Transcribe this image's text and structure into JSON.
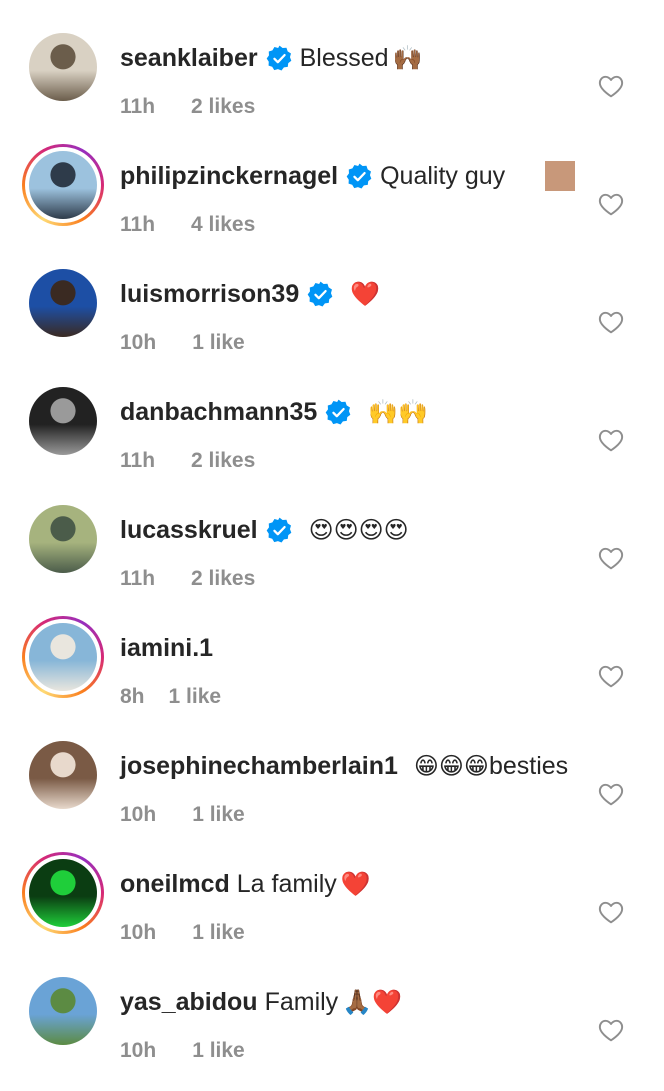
{
  "comments": [
    {
      "username": "seanklaiber",
      "verified": true,
      "text": "Blessed",
      "emoji": "🙌🏾",
      "time": "11h",
      "likes": "2 likes",
      "story": false,
      "avatar": [
        "#d9d1c3",
        "#6b5d4b"
      ]
    },
    {
      "username": "philipzinckernagel",
      "verified": true,
      "text": "Quality guy",
      "emoji": "",
      "time": "11h",
      "likes": "4 likes",
      "story": true,
      "avatar": [
        "#9cc2de",
        "#2e3b4a"
      ]
    },
    {
      "username": "luismorrison39",
      "verified": true,
      "text": "",
      "emoji": "❤️",
      "time": "10h",
      "likes": "1 like",
      "story": false,
      "avatar": [
        "#1d4fa5",
        "#3a2a22"
      ]
    },
    {
      "username": "danbachmann35",
      "verified": true,
      "text": "",
      "emoji": "🙌🙌",
      "time": "11h",
      "likes": "2 likes",
      "story": false,
      "avatar": [
        "#222222",
        "#9a9a9a"
      ]
    },
    {
      "username": "lucasskruel",
      "verified": true,
      "text": "",
      "emoji": "😍😍😍😍",
      "time": "11h",
      "likes": "2 likes",
      "story": false,
      "avatar": [
        "#a6b37e",
        "#4b5c4a"
      ]
    },
    {
      "username": "iamini.1",
      "verified": false,
      "text": "",
      "emoji": "",
      "time": "8h",
      "likes": "1 like",
      "story": true,
      "avatar": [
        "#87b6d8",
        "#e9e6de"
      ]
    },
    {
      "username": "josephinechamberlain1",
      "verified": false,
      "text": "besties",
      "emoji": "😁😁😁",
      "time": "10h",
      "likes": "1 like",
      "story": false,
      "avatar": [
        "#7a5a45",
        "#e8d9cc"
      ]
    },
    {
      "username": "oneilmcd",
      "verified": false,
      "text": "La family",
      "emoji": "❤️",
      "time": "10h",
      "likes": "1 like",
      "story": true,
      "avatar": [
        "#0b3d12",
        "#1fce3a"
      ]
    },
    {
      "username": "yas_abidou",
      "verified": false,
      "text": "Family",
      "emoji": "🙏🏾❤️",
      "time": "10h",
      "likes": "1 like",
      "story": false,
      "avatar": [
        "#6aa3d6",
        "#5c8b43"
      ]
    }
  ],
  "colors": {
    "verified": "#0095f6",
    "meta": "#8e8e8e",
    "text": "#262626",
    "heart_red": "#e0202c"
  }
}
